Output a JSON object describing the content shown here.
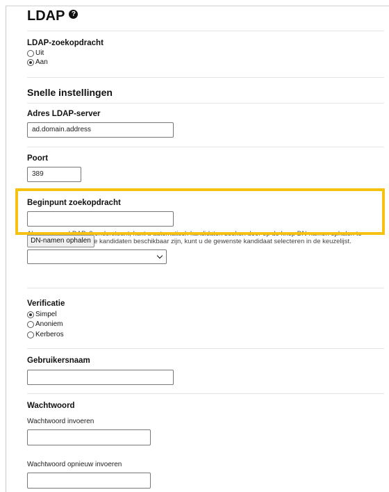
{
  "page": {
    "title": "LDAP",
    "help_icon": "question-circle-icon"
  },
  "ldap_search": {
    "label": "LDAP-zoekopdracht",
    "options": [
      {
        "label": "Uit",
        "checked": false
      },
      {
        "label": "Aan",
        "checked": true
      }
    ]
  },
  "quick_settings": {
    "title": "Snelle instellingen"
  },
  "server_address": {
    "label": "Adres LDAP-server",
    "value": "ad.domain.address"
  },
  "port": {
    "label": "Poort",
    "value": "389"
  },
  "search_root": {
    "label": "Beginpunt zoekopdracht",
    "value": "",
    "help": "Als uw server LDAPv3 ondersteunt, kunt u automatisch kandidaten zoeken door op de knop DN-namen ophalen te klikken. Als er meerdere kandidaten beschikbaar zijn, kunt u de gewenste kandidaat selecteren in de keuzelijst.",
    "fetch_button": "DN-namen ophalen",
    "highlight_color": "#f5c211"
  },
  "authentication": {
    "label": "Verificatie",
    "options": [
      {
        "label": "Simpel",
        "checked": true
      },
      {
        "label": "Anoniem",
        "checked": false
      },
      {
        "label": "Kerberos",
        "checked": false
      }
    ]
  },
  "username": {
    "label": "Gebruikersnaam",
    "value": ""
  },
  "password": {
    "label": "Wachtwoord",
    "enter_label": "Wachtwoord invoeren",
    "confirm_label": "Wachtwoord opnieuw invoeren"
  }
}
